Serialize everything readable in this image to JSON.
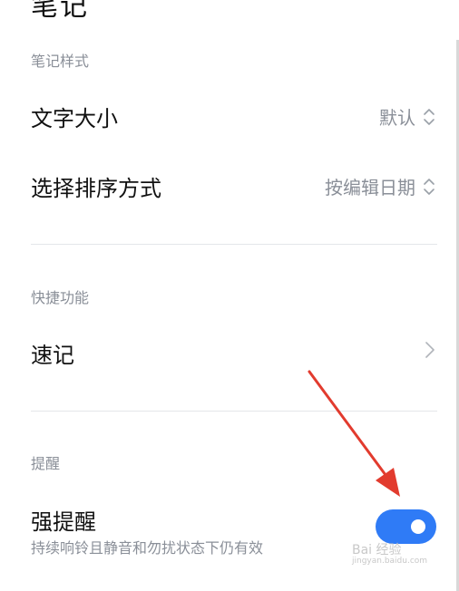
{
  "header": {
    "title_clipped": "笔记"
  },
  "sections": {
    "note_style": {
      "label": "笔记样式",
      "font_size": {
        "title": "文字大小",
        "value": "默认"
      },
      "sort": {
        "title": "选择排序方式",
        "value": "按编辑日期"
      }
    },
    "quick": {
      "label": "快捷功能",
      "quick_note": {
        "title": "速记"
      }
    },
    "reminder": {
      "label": "提醒",
      "strong_reminder": {
        "title": "强提醒",
        "description": "持续响铃且静音和勿扰状态下仍有效",
        "enabled": true
      }
    }
  },
  "watermark": {
    "text": "Bai 经验",
    "url": "jingyan.baidu.com"
  },
  "colors": {
    "accent": "#2f7bf6",
    "arrow": "#e23b2e",
    "muted": "#8a8f98"
  }
}
